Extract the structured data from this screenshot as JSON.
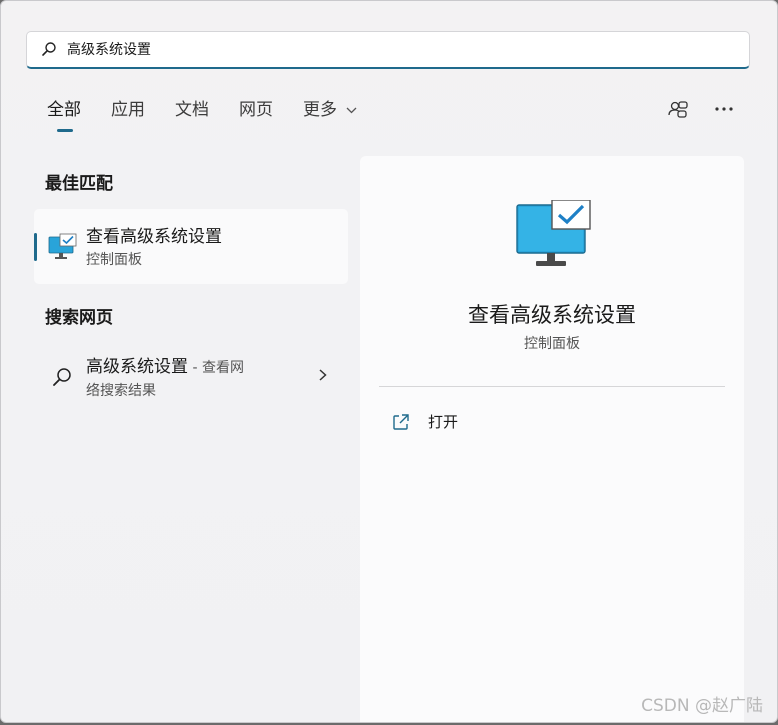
{
  "search": {
    "value": "高级系统设置"
  },
  "tabs": [
    {
      "label": "全部",
      "active": true
    },
    {
      "label": "应用"
    },
    {
      "label": "文档"
    },
    {
      "label": "网页"
    },
    {
      "label": "更多"
    }
  ],
  "sections": {
    "best_match": "最佳匹配",
    "search_web": "搜索网页"
  },
  "best_result": {
    "title": "查看高级系统设置",
    "subtitle": "控制面板",
    "icon": "monitor-check-icon"
  },
  "web_result": {
    "title": "高级系统设置",
    "title_suffix": " - 查看网",
    "subtitle": "络搜索结果",
    "icon": "search-icon"
  },
  "detail": {
    "title": "查看高级系统设置",
    "subtitle": "控制面板",
    "actions": [
      {
        "label": "打开",
        "icon": "open-external-icon"
      }
    ]
  },
  "watermark": "CSDN @赵广陆",
  "colors": {
    "accent": "#1f6a8c",
    "monitor_blue": "#29a4d9"
  }
}
